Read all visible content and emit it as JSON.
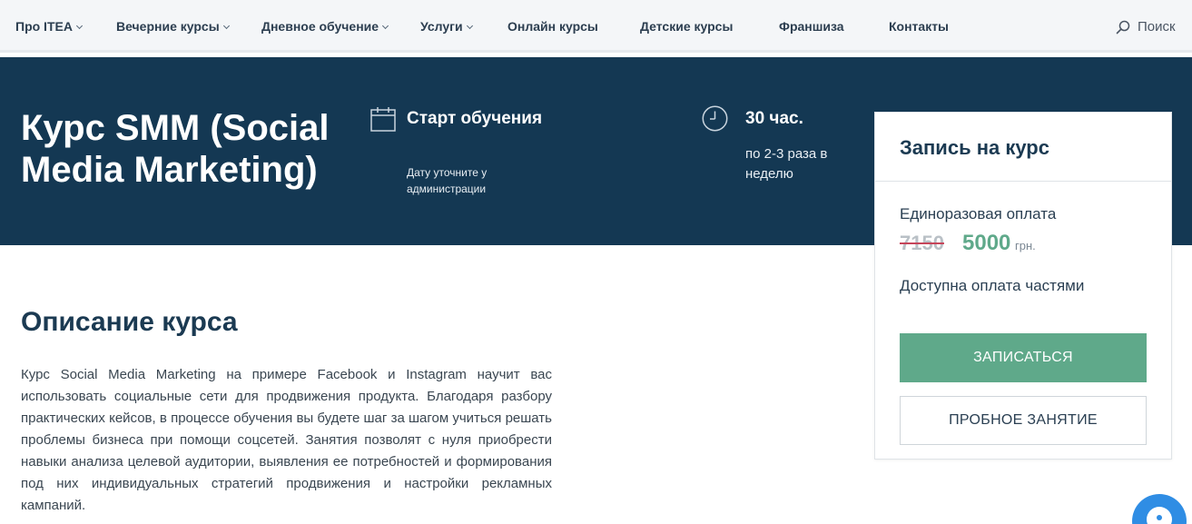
{
  "nav": {
    "items": [
      {
        "label": "Про ITEA",
        "has_dropdown": true
      },
      {
        "label": "Вечерние курсы",
        "has_dropdown": true
      },
      {
        "label": "Дневное обучение",
        "has_dropdown": true
      },
      {
        "label": "Услуги",
        "has_dropdown": true
      },
      {
        "label": "Онлайн курсы",
        "has_dropdown": false
      },
      {
        "label": "Детские курсы",
        "has_dropdown": false
      },
      {
        "label": "Франшиза",
        "has_dropdown": false
      },
      {
        "label": "Контакты",
        "has_dropdown": false
      }
    ],
    "search_label": "Поиск",
    "search_icon": "search-icon"
  },
  "hero": {
    "title": "Курс SMM (Social Media Marketing)",
    "start": {
      "icon": "calendar-icon",
      "title": "Старт обучения",
      "note": "Дату уточните у администрации"
    },
    "duration": {
      "icon": "clock-icon",
      "hours": "30 час.",
      "frequency": "по 2-3 раза в неделю"
    }
  },
  "enroll_card": {
    "title": "Запись на курс",
    "payment_label": "Единоразовая оплата",
    "old_price": "7150",
    "new_price": "5000",
    "currency": "грн.",
    "installments": "Доступна оплата частями",
    "enroll_button": "ЗАПИСАТЬСЯ",
    "trial_button": "ПРОБНОЕ ЗАНЯТИЕ"
  },
  "description": {
    "title": "Описание курса",
    "text": "Курс Social Media Marketing на примере Facebook и Instagram научит вас использовать социальные сети для продвижения продукта. Благодаря разбору практических кейсов, в процессе обучения вы будете шаг за шагом учиться решать проблемы бизнеса при помощи соцсетей. Занятия позволят с нуля приобрести навыки анализа целевой аудитории, выявления ее потребностей и формирования под них индивидуальных стратегий продвижения и настройки рекламных кампаний."
  },
  "chat": {
    "icon": "chat-icon"
  },
  "colors": {
    "hero_bg": "#143853",
    "accent_green": "#5fa98a",
    "strike_red": "#c6455a",
    "nav_bg": "#f4f6f8",
    "chat_blue": "#2f8de4"
  }
}
